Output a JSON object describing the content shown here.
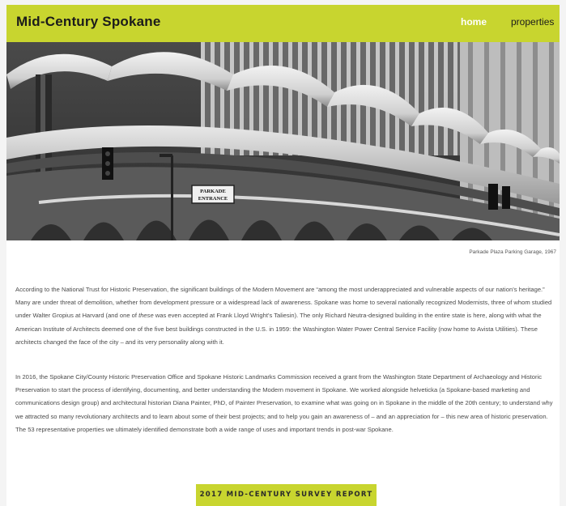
{
  "header": {
    "site_title": "Mid-Century Spokane",
    "nav": [
      {
        "label": "home",
        "active": true
      },
      {
        "label": "properties",
        "active": false
      }
    ]
  },
  "hero": {
    "sign_line1": "PARKADE",
    "sign_line2": "ENTRANCE",
    "caption": "Parkade Plaza Parking Garage, 1967"
  },
  "intro": {
    "p1_a": "According to the National Trust for Historic Preservation, the significant buildings of the Modern Movement are “among the most underappreciated and vulnerable aspects of our nation’s heritage.” Many are under threat of demolition, whether from development pressure or a widespread lack of awareness. Spokane was home to several nationally recognized Modernists, three of whom studied under Walter Gropius at Harvard (and one of ",
    "p1_em": "these",
    "p1_b": " was even accepted at Frank Lloyd Wright’s Taliesin). The only Richard Neutra-designed building in the entire state is here, along with what the American Institute of Architects deemed one of the five best buildings constructed in the U.S. in 1959: the Washington Water Power Central Service Facility (now home to Avista Utilities). These architects changed the face of the city – and its very personality along with it.",
    "p2": "In 2016, the Spokane City/County Historic Preservation Office and Spokane Historic Landmarks Commission received a grant from the Washington State Department of Archaeology and Historic Preservation to start the process of identifying, documenting, and better understanding the Modern movement in Spokane. We worked alongside helveticka (a Spokane-based marketing and communications design group) and architectural historian Diana Painter, PhD, of Painter Preservation, to examine what was going on in Spokane in the middle of the 20th century; to understand why we attracted so many revolutionary architects and to learn about some of their best projects; and to help you gain an awareness of – and an appreciation for – this new area of historic preservation. The 53 representative properties we ultimately identified demonstrate both a wide range of uses and important trends in post-war Spokane."
  },
  "cta": {
    "label": "2017 MID-CENTURY SURVEY REPORT"
  },
  "colors": {
    "accent": "#c8d52f",
    "text": "#4a4a4a",
    "header_text": "#1b1b1b"
  }
}
